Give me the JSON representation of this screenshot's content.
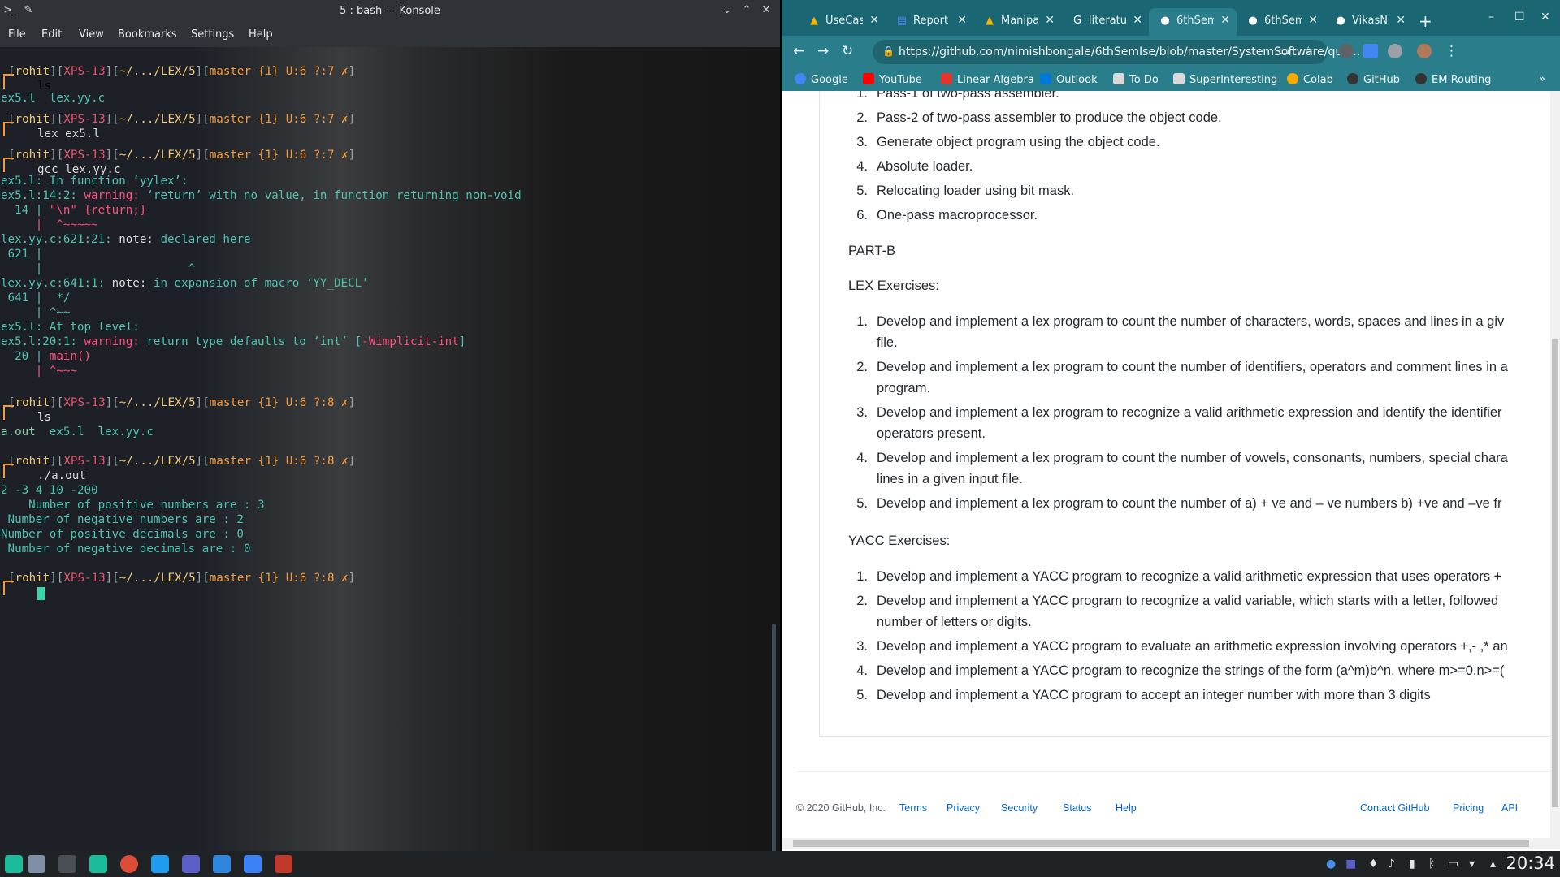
{
  "konsole": {
    "title": "5 : bash — Konsole",
    "menu": [
      "File",
      "Edit",
      "View",
      "Bookmarks",
      "Settings",
      "Help"
    ],
    "prompts": [
      {
        "user": "rohit",
        "host": "XPS-13",
        "dir": "~/.../LEX/5",
        "branch": "master {1} U:6 ?:7 ✗",
        "cmd": "ls"
      },
      {
        "user": "rohit",
        "host": "XPS-13",
        "dir": "~/.../LEX/5",
        "branch": "master {1} U:6 ?:7 ✗",
        "cmd": "lex ex5.l"
      },
      {
        "user": "rohit",
        "host": "XPS-13",
        "dir": "~/.../LEX/5",
        "branch": "master {1} U:6 ?:7 ✗",
        "cmd": "gcc lex.yy.c"
      },
      {
        "user": "rohit",
        "host": "XPS-13",
        "dir": "~/.../LEX/5",
        "branch": "master {1} U:6 ?:8 ✗",
        "cmd": "ls"
      },
      {
        "user": "rohit",
        "host": "XPS-13",
        "dir": "~/.../LEX/5",
        "branch": "master {1} U:6 ?:8 ✗",
        "cmd": "./a.out"
      },
      {
        "user": "rohit",
        "host": "XPS-13",
        "dir": "~/.../LEX/5",
        "branch": "master {1} U:6 ?:8 ✗",
        "cmd": ""
      }
    ],
    "output": {
      "ls1": "ex5.l  lex.yy.c",
      "gcc": [
        "ex5.l: In function ‘yylex’:",
        "ex5.l:14:2: ",
        "warning: ",
        "‘return’ with no value, in function returning non-void",
        "  14 | ",
        "\"\\n\" {return;}",
        "     |  ^~~~~~",
        "lex.yy.c:621:21: ",
        "note: ",
        "declared here",
        " 621 |",
        "     |                     ^",
        "lex.yy.c:641:1: ",
        "note: ",
        "in expansion of macro ‘YY_DECL’",
        " 641 |  */",
        "     | ^~~",
        "ex5.l: At top level:",
        "ex5.l:20:1: ",
        "warning: ",
        "return type defaults to ‘int’ [",
        "-Wimplicit-int",
        "]",
        "  20 | ",
        "main()",
        "     | ^~~~"
      ],
      "ls2_a": "a.out",
      "ls2_b": "  ex5.l  lex.yy.c",
      "input": "2 -3 4 10 -200",
      "result": [
        "    Number of positive numbers are : 3",
        " Number of negative numbers are : 2",
        "Number of positive decimals are : 0",
        " Number of negative decimals are : 0"
      ]
    }
  },
  "chrome": {
    "tabs": [
      {
        "label": "UseCas",
        "icon": "drive-icon",
        "color": "#f4b400"
      },
      {
        "label": "Report",
        "icon": "docs-icon",
        "color": "#4285f4"
      },
      {
        "label": "Manipa",
        "icon": "drive-icon",
        "color": "#f4b400"
      },
      {
        "label": "literatu",
        "icon": "google-icon",
        "color": "#ffffff"
      },
      {
        "label": "6thSem",
        "icon": "github-icon",
        "color": "#ffffff"
      },
      {
        "label": "6thSem",
        "icon": "github-icon",
        "color": "#ffffff"
      },
      {
        "label": "VikasN",
        "icon": "github-icon",
        "color": "#ffffff"
      }
    ],
    "url": "https://github.com/nimishbongale/6thSemIse/blob/master/SystemSoftware/que...",
    "bookmarks": [
      {
        "label": "Google",
        "color": "#4285f4"
      },
      {
        "label": "YouTube",
        "color": "#ff0000"
      },
      {
        "label": "Linear Algebra",
        "color": "#e3342f"
      },
      {
        "label": "Outlook",
        "color": "#0078d4"
      },
      {
        "label": "To Do",
        "color": "#d9d9d9"
      },
      {
        "label": "SuperInteresting",
        "color": "#d9d9d9"
      },
      {
        "label": "Colab",
        "color": "#f9ab00"
      },
      {
        "label": "GitHub",
        "color": "#333333"
      },
      {
        "label": "EM Routing",
        "color": "#333333"
      }
    ],
    "parta_items": [
      "Pass-1 of two-pass assembler.",
      "Pass-2 of two-pass assembler to produce the object code.",
      "Generate object program using the object code.",
      "Absolute loader.",
      "Relocating loader using bit mask.",
      "One-pass macroprocessor."
    ],
    "partb_heading": "PART-B",
    "lex_heading": "LEX Exercises:",
    "lex_items": [
      [
        "Develop and implement a lex program to count the number of characters, words, spaces and lines in a giv",
        "file."
      ],
      [
        "Develop and implement a lex program to count the number of identifiers, operators and comment lines in a",
        "program."
      ],
      [
        "Develop and implement a lex program to recognize a valid arithmetic expression and identify the identifier",
        "operators present."
      ],
      [
        "Develop and implement a lex program to count the number of vowels, consonants, numbers, special chara",
        "lines in a given input file."
      ],
      [
        "Develop and implement a lex program to count the number of a) + ve and – ve numbers b) +ve and –ve fr",
        ""
      ]
    ],
    "yacc_heading": "YACC Exercises:",
    "yacc_items": [
      [
        "Develop and implement a YACC program to recognize a valid arithmetic expression that uses operators +",
        ""
      ],
      [
        "Develop and implement a YACC program to recognize a valid variable, which starts with a letter, followed",
        "number of letters or digits."
      ],
      [
        "Develop and implement a YACC program to evaluate an arithmetic expression involving operators +,- ,* an",
        ""
      ],
      [
        "Develop and implement a YACC program to recognize the strings of the form (a^m)b^n, where m>=0,n>=(",
        ""
      ],
      [
        "Develop and implement a YACC program to accept an integer number with more than 3 digits",
        ""
      ]
    ],
    "footer": {
      "copyright": "© 2020 GitHub, Inc.",
      "left_links": [
        "Terms",
        "Privacy",
        "Security",
        "Status",
        "Help"
      ],
      "right_links": [
        "Contact GitHub",
        "Pricing",
        "API"
      ]
    }
  },
  "taskbar": {
    "clock": "20:34"
  }
}
